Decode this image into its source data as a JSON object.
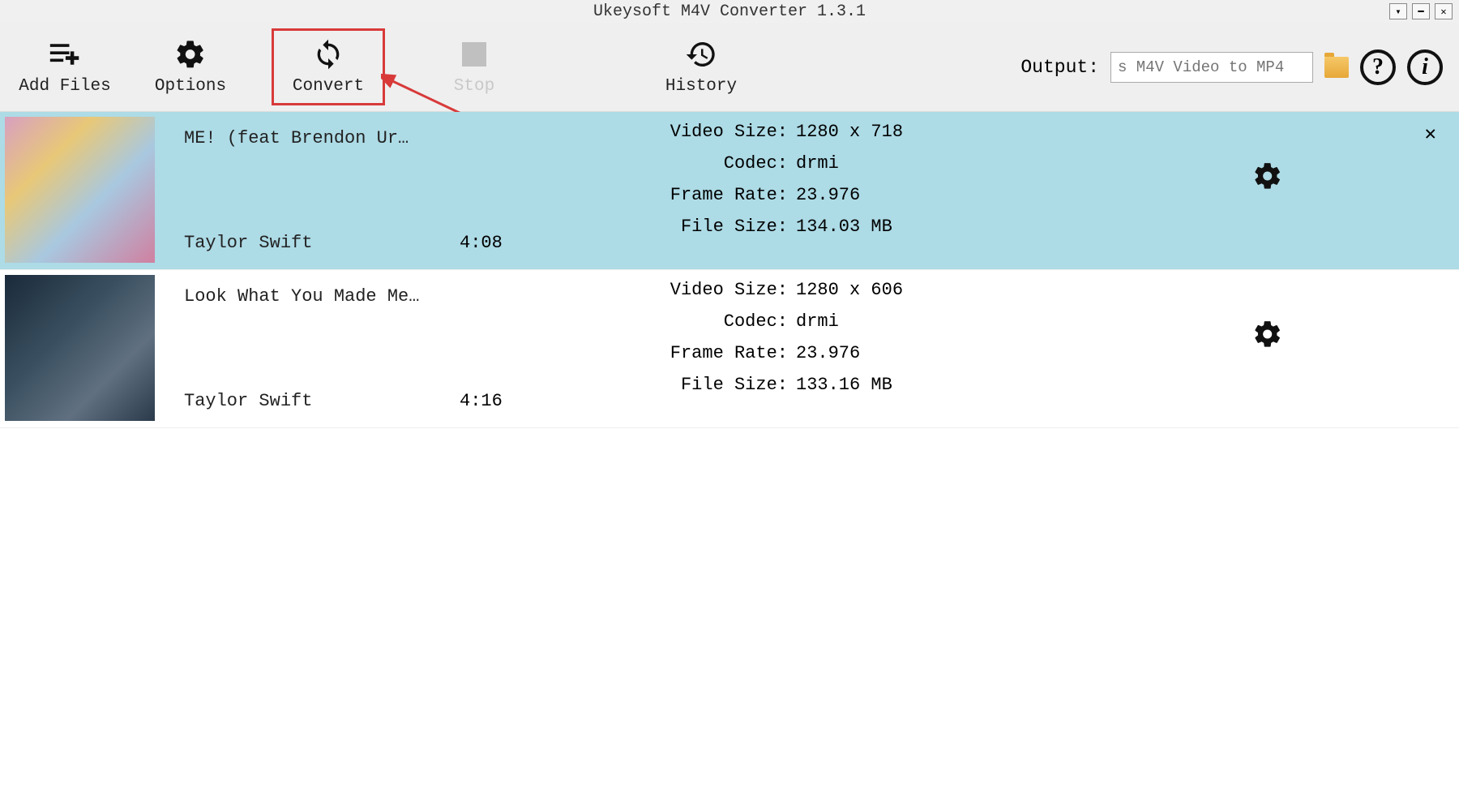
{
  "window": {
    "title": "Ukeysoft M4V Converter 1.3.1"
  },
  "toolbar": {
    "add_files": "Add Files",
    "options": "Options",
    "convert": "Convert",
    "stop": "Stop",
    "history": "History",
    "output_label": "Output:",
    "output_placeholder": "s M4V Video to MP4"
  },
  "labels": {
    "video_size": "Video Size:",
    "codec": "Codec:",
    "frame_rate": "Frame Rate:",
    "file_size": "File Size:"
  },
  "files": [
    {
      "title": "ME! (feat  Brendon Ur…",
      "artist": "Taylor Swift",
      "duration": "4:08",
      "video_size": "1280 x 718",
      "codec": "drmi",
      "frame_rate": "23.976",
      "file_size": "134.03 MB",
      "selected": true
    },
    {
      "title": "Look What You Made Me…",
      "artist": "Taylor Swift",
      "duration": "4:16",
      "video_size": "1280 x 606",
      "codec": "drmi",
      "frame_rate": "23.976",
      "file_size": "133.16 MB",
      "selected": false
    }
  ]
}
